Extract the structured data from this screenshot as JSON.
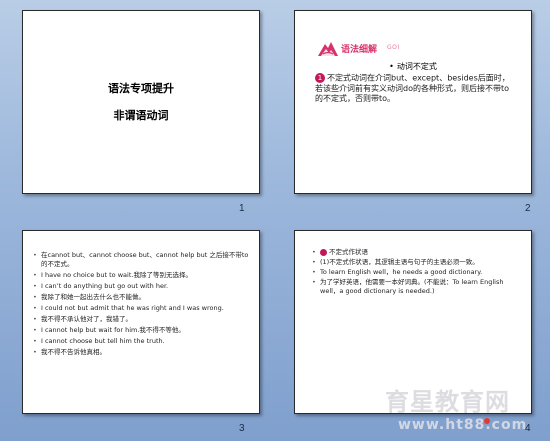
{
  "slides": [
    {
      "number": "1",
      "title": "语法专项提升",
      "subtitle": "非谓语动词"
    },
    {
      "number": "2",
      "logo_text": "语法细解",
      "logo_suffix": "GOI",
      "subtitle_bullet": "•",
      "subtitle": "动词不定式",
      "pin": "1",
      "body": "不定式动词在介词but、except、besides后面时，若该些介词前有实义动词do的各种形式，则后接不带to的不定式，否则带to。"
    },
    {
      "number": "3",
      "items": [
        "在cannot but、cannot choose but、cannot help but 之后接不带to的不定式。",
        "I have no choice but to wait.我除了等别无选择。",
        "I can’t do anything but go out with her.",
        "我除了和她一起出去什么也不能做。",
        "I could not but admit that he was right and I was wrong.",
        "我不得不承认他对了，我错了。",
        "I cannot help but wait for him.我不得不等他。",
        "I cannot choose but tell him the truth.",
        "我不得不告诉他真相。"
      ]
    },
    {
      "number": "4",
      "items": [
        "不定式作状语",
        "(1)不定式作状语，其逻辑主语与句子的主语必须一致。",
        "To learn English well，he needs a good dictionary.",
        "为了学好英语，他需要一本好词典。(不能说：To learn English well，a good dictionary is needed.)"
      ]
    }
  ],
  "watermark": {
    "line1": "育星教育网",
    "line2": "www.ht88.com"
  },
  "colors": {
    "logo_pink": "#d6336c",
    "pin_magenta": "#c2185b",
    "background": "#9db8dc"
  }
}
